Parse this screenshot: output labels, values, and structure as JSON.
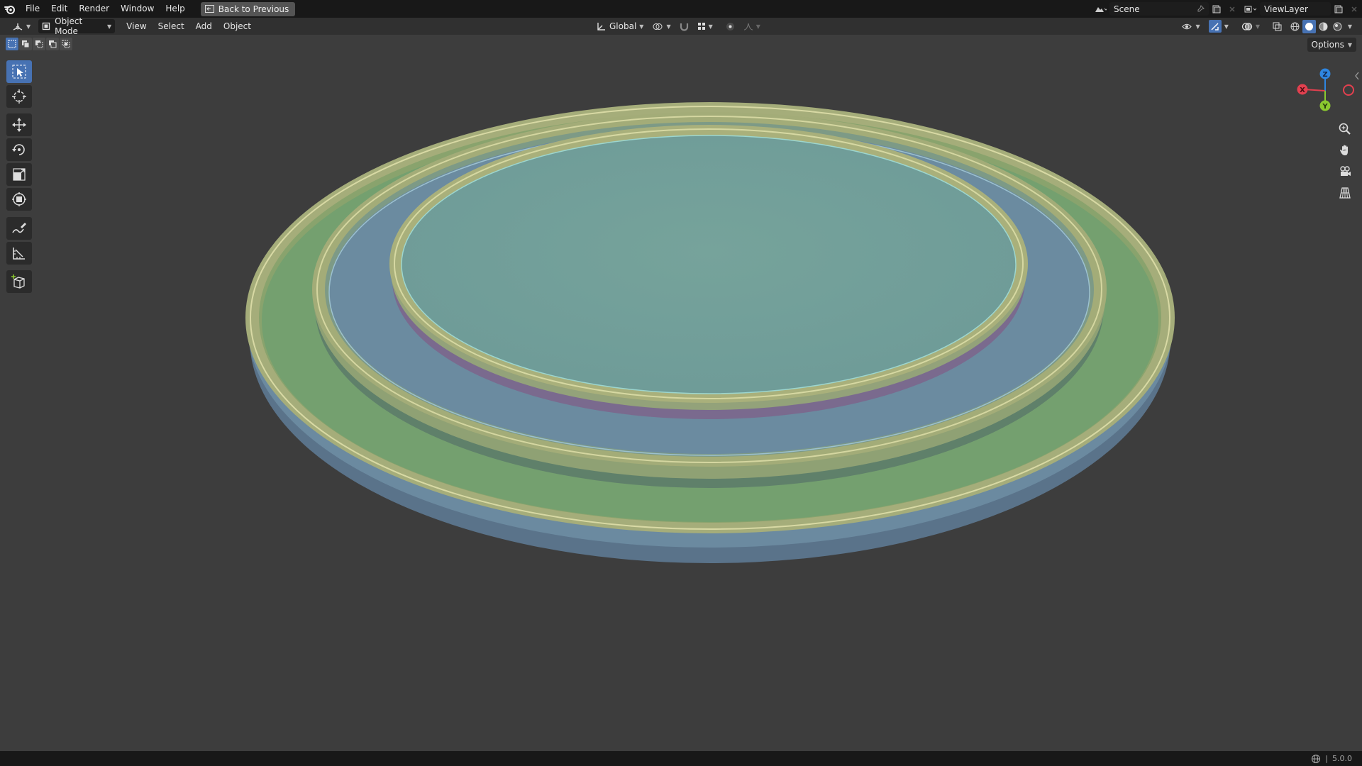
{
  "menu": {
    "items": [
      "File",
      "Edit",
      "Render",
      "Window",
      "Help"
    ],
    "back_label": "Back to Previous"
  },
  "topright": {
    "scene": "Scene",
    "view_layer": "ViewLayer"
  },
  "header": {
    "mode": "Object Mode",
    "menus": [
      "View",
      "Select",
      "Add",
      "Object"
    ],
    "orientation": "Global"
  },
  "options_label": "Options",
  "gizmo": {
    "x": "X",
    "y": "Y",
    "z": "Z"
  },
  "status": {
    "version": "5.0.0"
  },
  "colors": {
    "accent": "#4772b3",
    "axis_x": "#e2404f",
    "axis_y": "#8bc92f",
    "axis_z": "#2f86e0"
  }
}
